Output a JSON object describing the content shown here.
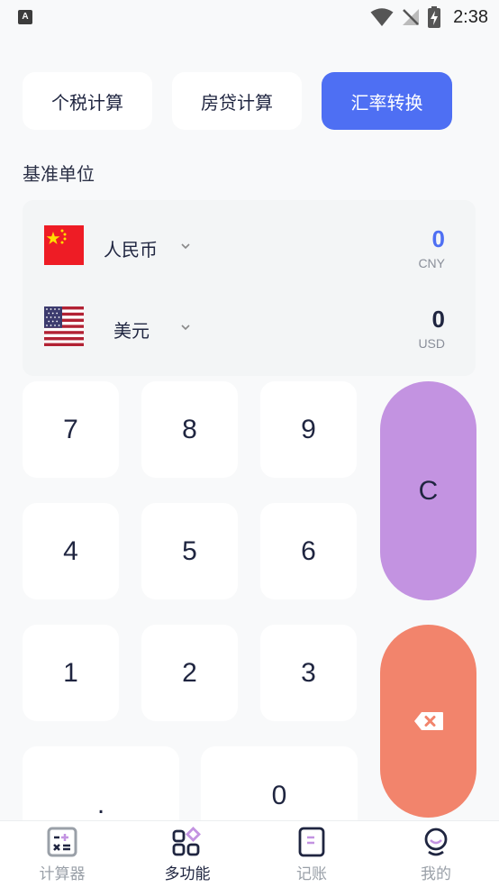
{
  "status_bar": {
    "time": "2:38"
  },
  "tabs": [
    {
      "label": "个税计算",
      "active": false
    },
    {
      "label": "房贷计算",
      "active": false
    },
    {
      "label": "汇率转换",
      "active": true
    }
  ],
  "base_unit_label": "基准单位",
  "currencies": [
    {
      "name": "人民币",
      "code": "CNY",
      "amount": "0",
      "flag_icon": "china-flag-icon",
      "amount_color": "#4e6ff3"
    },
    {
      "name": "美元",
      "code": "USD",
      "amount": "0",
      "flag_icon": "usa-flag-icon",
      "amount_color": "#1f2540"
    }
  ],
  "keypad": {
    "keys": [
      "7",
      "8",
      "9",
      "4",
      "5",
      "6",
      "1",
      "2",
      "3",
      ".",
      "0"
    ],
    "clear_label": "C",
    "backspace_icon": "backspace-icon",
    "clear_color": "#c393e1",
    "backspace_color": "#f2846c"
  },
  "bottom_nav": [
    {
      "label": "计算器",
      "icon": "calculator-icon",
      "active": false
    },
    {
      "label": "多功能",
      "icon": "apps-icon",
      "active": true
    },
    {
      "label": "记账",
      "icon": "ledger-icon",
      "active": false
    },
    {
      "label": "我的",
      "icon": "profile-icon",
      "active": false
    }
  ],
  "colors": {
    "accent": "#4e6ff3",
    "background": "#f8f9fa",
    "text": "#1f2540"
  }
}
